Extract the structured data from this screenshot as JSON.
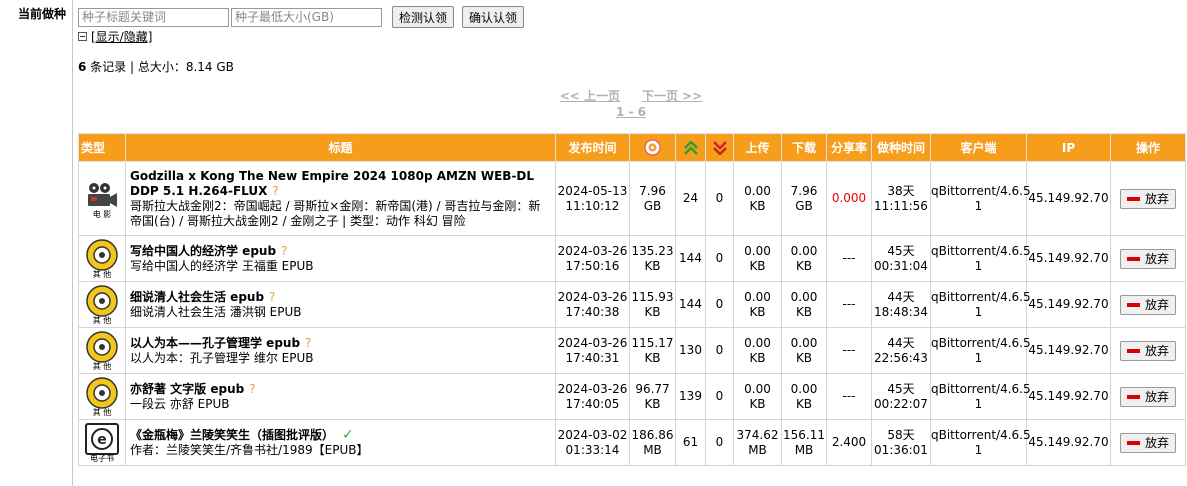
{
  "section_label": "当前做种",
  "filter": {
    "keyword_placeholder": "种子标题关键词",
    "size_placeholder": "种子最低大小(GB)",
    "detect_button": "检测认领",
    "confirm_button": "确认认领"
  },
  "toggle_label": "[显示/隐藏]",
  "summary": {
    "count": "6",
    "text": " 条记录 | 总大小：8.14 GB"
  },
  "pager": {
    "prev": "<< 上一页",
    "next": "下一页 >>",
    "range": "1 - 6"
  },
  "headers": {
    "type": "类型",
    "title": "标题",
    "published": "发布时间",
    "upload": "上传",
    "download": "下载",
    "ratio": "分享率",
    "seed_time": "做种时间",
    "client": "客户端",
    "ip": "IP",
    "action": "操作"
  },
  "rows": [
    {
      "cat": "movie",
      "cat_label": "电 影",
      "name": "Godzilla x Kong The New Empire 2024 1080p AMZN WEB-DL DDP 5.1 H.264-FLUX",
      "mark": "?",
      "sub": "哥斯拉大战金刚2：帝国崛起 / 哥斯拉×金刚：新帝国(港) / 哥吉拉与金刚：新帝国(台) / 哥斯拉大战金刚2 / 金刚之子 | 类型：动作 科幻 冒险",
      "date": "2024-05-13",
      "time": "11:10:12",
      "size_v": "7.96",
      "size_u": "GB",
      "seeders": "24",
      "leechers": "0",
      "up_v": "0.00",
      "up_u": "KB",
      "down_v": "7.96",
      "down_u": "GB",
      "ratio": "0.000",
      "ratio_red": true,
      "seed_d": "38天",
      "seed_t": "11:11:56",
      "client": "qBittorrent/4.6.5",
      "client2": "1",
      "ip": "45.149.92.70",
      "action": "放弃"
    },
    {
      "cat": "other",
      "cat_label": "其 他",
      "name": "写给中国人的经济学 epub",
      "mark": "?",
      "sub": "写给中国人的经济学 王福重 EPUB",
      "date": "2024-03-26",
      "time": "17:50:16",
      "size_v": "135.23",
      "size_u": "KB",
      "seeders": "144",
      "leechers": "0",
      "up_v": "0.00",
      "up_u": "KB",
      "down_v": "0.00",
      "down_u": "KB",
      "ratio": "---",
      "ratio_red": false,
      "seed_d": "45天",
      "seed_t": "00:31:04",
      "client": "qBittorrent/4.6.5",
      "client2": "1",
      "ip": "45.149.92.70",
      "action": "放弃"
    },
    {
      "cat": "other",
      "cat_label": "其 他",
      "name": "细说清人社会生活 epub",
      "mark": "?",
      "sub": "细说清人社会生活 潘洪钢 EPUB",
      "date": "2024-03-26",
      "time": "17:40:38",
      "size_v": "115.93",
      "size_u": "KB",
      "seeders": "144",
      "leechers": "0",
      "up_v": "0.00",
      "up_u": "KB",
      "down_v": "0.00",
      "down_u": "KB",
      "ratio": "---",
      "ratio_red": false,
      "seed_d": "44天",
      "seed_t": "18:48:34",
      "client": "qBittorrent/4.6.5",
      "client2": "1",
      "ip": "45.149.92.70",
      "action": "放弃"
    },
    {
      "cat": "other",
      "cat_label": "其 他",
      "name": "以人为本——孔子管理学 epub",
      "mark": "?",
      "sub": "以人为本：孔子管理学 维尔 EPUB",
      "date": "2024-03-26",
      "time": "17:40:31",
      "size_v": "115.17",
      "size_u": "KB",
      "seeders": "130",
      "leechers": "0",
      "up_v": "0.00",
      "up_u": "KB",
      "down_v": "0.00",
      "down_u": "KB",
      "ratio": "---",
      "ratio_red": false,
      "seed_d": "44天",
      "seed_t": "22:56:43",
      "client": "qBittorrent/4.6.5",
      "client2": "1",
      "ip": "45.149.92.70",
      "action": "放弃"
    },
    {
      "cat": "other",
      "cat_label": "其 他",
      "name": "亦舒著 文字版 epub",
      "mark": "?",
      "sub": "一段云 亦舒 EPUB",
      "date": "2024-03-26",
      "time": "17:40:05",
      "size_v": "96.77",
      "size_u": "KB",
      "seeders": "139",
      "leechers": "0",
      "up_v": "0.00",
      "up_u": "KB",
      "down_v": "0.00",
      "down_u": "KB",
      "ratio": "---",
      "ratio_red": false,
      "seed_d": "45天",
      "seed_t": "00:22:07",
      "client": "qBittorrent/4.6.5",
      "client2": "1",
      "ip": "45.149.92.70",
      "action": "放弃"
    },
    {
      "cat": "ebook",
      "cat_label": "电子书",
      "name": "《金瓶梅》兰陵笑笑生（插图批评版）",
      "mark": "✓",
      "sub": "作者：兰陵笑笑生/齐鲁书社/1989【EPUB】",
      "date": "2024-03-02",
      "time": "01:33:14",
      "size_v": "186.86",
      "size_u": "MB",
      "seeders": "61",
      "leechers": "0",
      "up_v": "374.62",
      "up_u": "MB",
      "down_v": "156.11",
      "down_u": "MB",
      "ratio": "2.400",
      "ratio_red": false,
      "seed_d": "58天",
      "seed_t": "01:36:01",
      "client": "qBittorrent/4.6.5",
      "client2": "1",
      "ip": "45.149.92.70",
      "action": "放弃"
    }
  ]
}
